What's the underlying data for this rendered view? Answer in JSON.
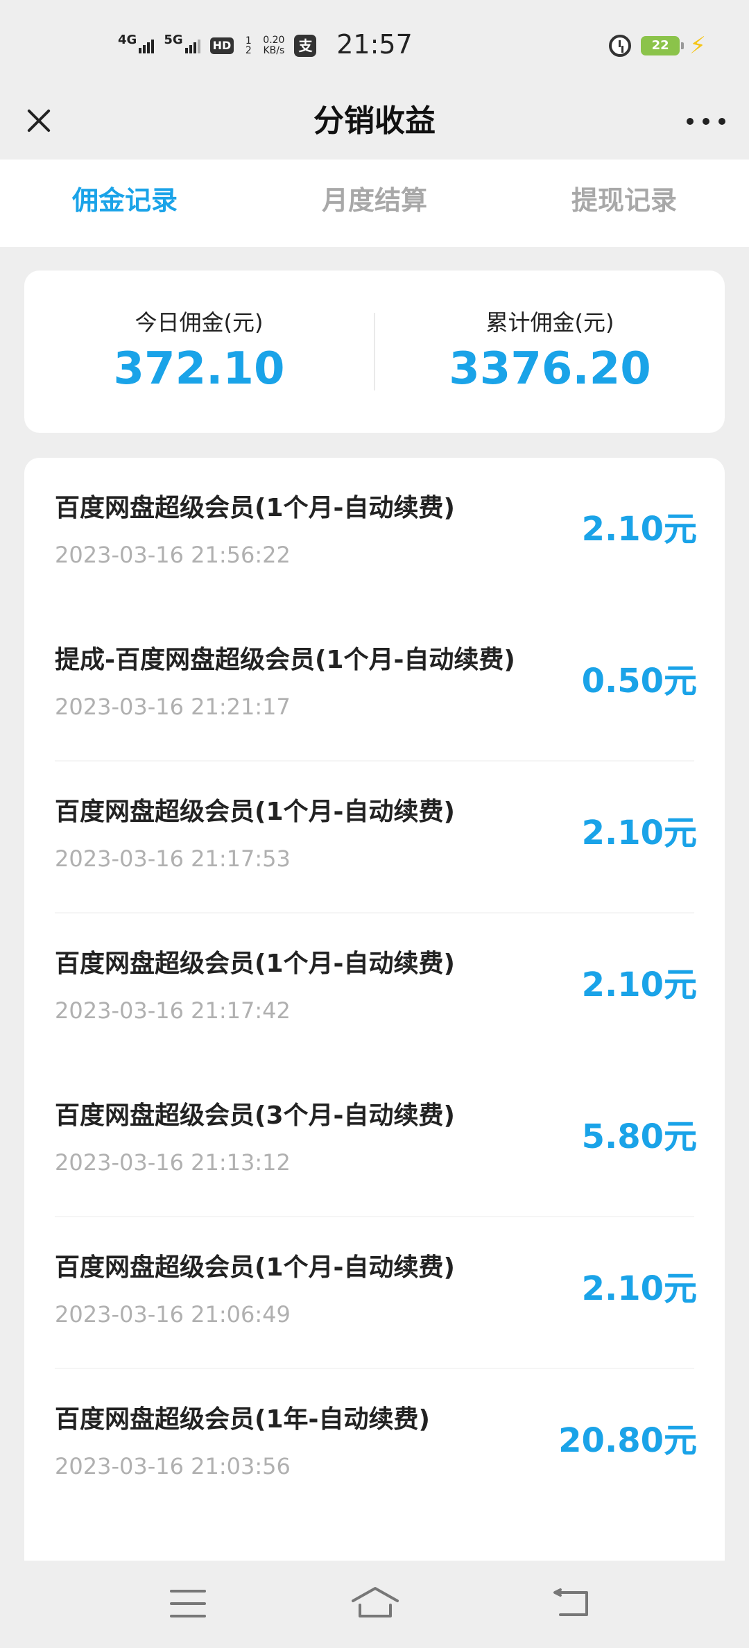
{
  "status_bar": {
    "sig1": "4G",
    "sig2": "5G",
    "hd": "HD",
    "hd_sims": "1 2",
    "speed_value": "0.20",
    "speed_unit": "KB/s",
    "pay_icon_glyph": "支",
    "time": "21:57",
    "battery": "22"
  },
  "header": {
    "title": "分销收益"
  },
  "tabs": [
    {
      "label": "佣金记录",
      "active": true
    },
    {
      "label": "月度结算",
      "active": false
    },
    {
      "label": "提现记录",
      "active": false
    }
  ],
  "summary": {
    "today_label": "今日佣金(元)",
    "today_value": "372.10",
    "total_label": "累计佣金(元)",
    "total_value": "3376.20"
  },
  "records": [
    {
      "name": "百度网盘超级会员(1个月-自动续费)",
      "time": "2023-03-16 21:56:22",
      "amount": "2.10元"
    },
    {
      "name": "提成-百度网盘超级会员(1个月-自动续费)",
      "time": "2023-03-16 21:21:17",
      "amount": "0.50元"
    },
    {
      "name": "百度网盘超级会员(1个月-自动续费)",
      "time": "2023-03-16 21:17:53",
      "amount": "2.10元"
    },
    {
      "name": "百度网盘超级会员(1个月-自动续费)",
      "time": "2023-03-16 21:17:42",
      "amount": "2.10元"
    },
    {
      "name": "百度网盘超级会员(3个月-自动续费)",
      "time": "2023-03-16 21:13:12",
      "amount": "5.80元"
    },
    {
      "name": "百度网盘超级会员(1个月-自动续费)",
      "time": "2023-03-16 21:06:49",
      "amount": "2.10元"
    },
    {
      "name": "百度网盘超级会员(1年-自动续费)",
      "time": "2023-03-16 21:03:56",
      "amount": "20.80元"
    }
  ],
  "colors": {
    "accent": "#1aa3e8",
    "inactive_tab": "#a8a8a8",
    "background": "#eeeeee"
  }
}
